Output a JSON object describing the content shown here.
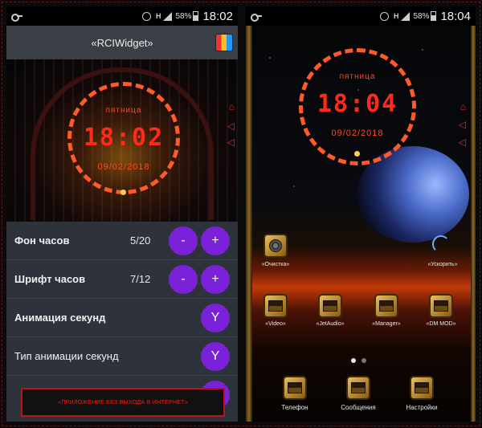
{
  "left": {
    "status": {
      "battery": "58%",
      "time": "18:02",
      "network": "H"
    },
    "appbar": {
      "title": "«RCIWidget»"
    },
    "widget": {
      "day": "пятница",
      "time": "18:02",
      "date": "09/02/2018"
    },
    "settings": [
      {
        "label": "Фон часов",
        "value": "5/20",
        "minus": "-",
        "plus": "+"
      },
      {
        "label": "Шрифт часов",
        "value": "7/12",
        "minus": "-",
        "plus": "+"
      },
      {
        "label": "Анимация секунд",
        "button": "Y"
      },
      {
        "label": "Тип анимации секунд",
        "button": "Y"
      }
    ],
    "banner": "«ПРИЛОЖЕНИЕ БЕЗ ВЫХОДА В ИНТЕРНЕТ»"
  },
  "right": {
    "status": {
      "battery": "58%",
      "time": "18:04",
      "network": "H"
    },
    "widget": {
      "day": "пятница",
      "time": "18:04",
      "date": "09/02/2018"
    },
    "icons_row1": [
      {
        "label": "«Очистка»",
        "icon": "cleaner-icon"
      },
      {
        "label": "«Ускорить»",
        "icon": "boost-icon"
      }
    ],
    "icons_row2": [
      {
        "label": "«Video»",
        "icon": "video-app-icon"
      },
      {
        "label": "«JetAudio»",
        "icon": "jetaudio-app-icon"
      },
      {
        "label": "«Manager»",
        "icon": "manager-app-icon"
      },
      {
        "label": "«DM MOD»",
        "icon": "dm-mod-app-icon"
      }
    ],
    "dock": [
      {
        "label": "Телефон",
        "icon": "phone-app-icon"
      },
      {
        "label": "Сообщения",
        "icon": "messages-app-icon"
      },
      {
        "label": "Настройки",
        "icon": "settings-app-icon"
      }
    ]
  },
  "colors": {
    "accent_purple": "#7b22d9",
    "clock_red": "#ff2a1a",
    "banner_red": "#b8141a"
  }
}
